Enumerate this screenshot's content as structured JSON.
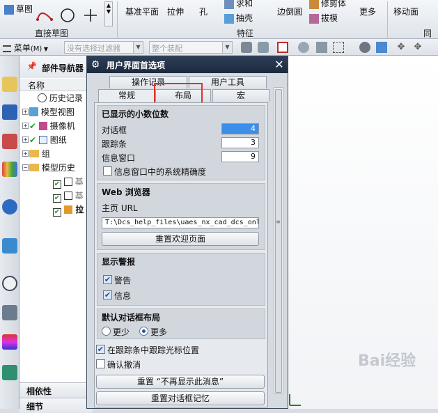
{
  "ribbon": {
    "sketch": "草图",
    "direct_sketch": "直接草图",
    "datum_plane": "基准平面",
    "extrude": "拉伸",
    "hole": "孔",
    "unite": "求和",
    "shell": "抽壳",
    "edge_blend": "边倒圆",
    "trim_body": "修剪体",
    "draft": "拔模",
    "more": "更多",
    "move_face": "移动面",
    "feature_group": "特征",
    "sync_group": "同步"
  },
  "toolbar": {
    "menu": "菜单",
    "menu_key": "(M)",
    "filter_placeholder": "没有选择过滤器",
    "assembly_placeholder": "整个装配"
  },
  "navigator": {
    "title": "部件导航器",
    "column_name": "名称",
    "items": [
      {
        "label": "历史记录"
      },
      {
        "label": "模型视图"
      },
      {
        "label": "摄像机"
      },
      {
        "label": "图纸"
      },
      {
        "label": "组"
      },
      {
        "label": "模型历史"
      },
      {
        "label": "基"
      },
      {
        "label": "基"
      },
      {
        "label": "拉"
      }
    ],
    "bottom_1": "相依性",
    "bottom_2": "细节"
  },
  "dialog": {
    "title": "用户界面首选项",
    "tabs_row1": [
      "操作记录",
      "用户工具"
    ],
    "tabs_row2": [
      "常规",
      "布局",
      "宏"
    ],
    "decimal_group": {
      "title": "已显示的小数位数",
      "dialog_label": "对话框",
      "dialog_value": "4",
      "tracking_label": "跟踪条",
      "tracking_value": "3",
      "info_label": "信息窗口",
      "info_value": "9",
      "system_precision_label": "信息窗口中的系统精确度"
    },
    "web_group": {
      "title": "Web 浏览器",
      "homepage_label": "主页 URL",
      "homepage_value": "T:\\Dcs_help_files\\uaes_nx_cad_dcs_onl",
      "reset_button": "重置欢迎页面"
    },
    "alert_group": {
      "title": "显示警报",
      "warning": "警告",
      "info": "信息"
    },
    "layout_group": {
      "title": "默认对话框布局",
      "less": "更少",
      "more": "更多"
    },
    "track_cursor": "在跟踪条中跟踪光标位置",
    "confirm_undo": "确认撤消",
    "reset_messages_button": "重置 “不再显示此消息”",
    "reset_layout_button": "重置对话框记忆"
  },
  "watermark": "Bai经验",
  "colors": {
    "highlight": "#e0322a",
    "title_bar": "#1f2d42",
    "selected_input": "#3d8ee8"
  }
}
